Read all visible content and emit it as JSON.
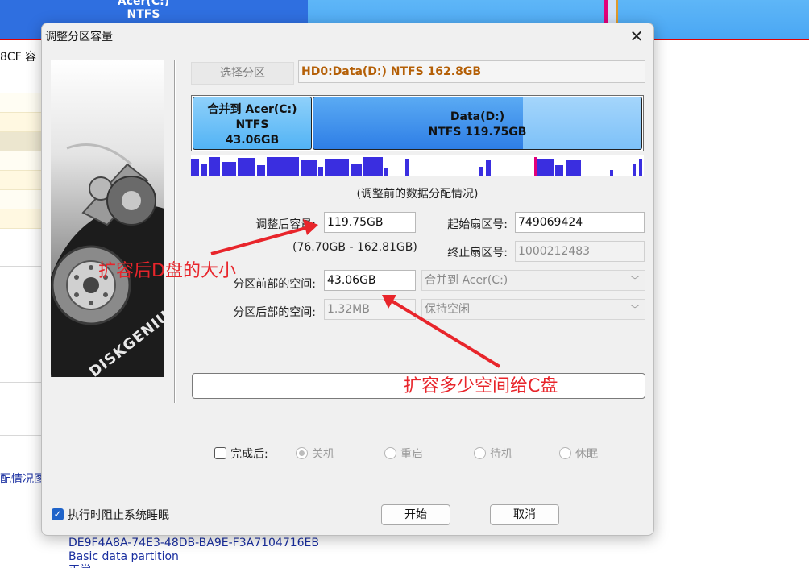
{
  "background": {
    "partition_c": {
      "name": "Acer(C:)",
      "fs": "NTFS"
    },
    "columns_text": "8CF  容",
    "link_text": "配情况图",
    "info_lines": [
      "DE9F4A8A-74E3-48DB-BA9E-F3A7104716EB",
      "Basic data partition",
      "正常"
    ]
  },
  "dialog": {
    "title": "调整分区容量",
    "close_symbol": "✕",
    "brand": "DISKGENIUS",
    "select_partition_label": "选择分区",
    "current_partition": "HD0:Data(D:) NTFS 162.8GB",
    "partition_bar": {
      "merge": {
        "line1": "合并到 Acer(C:)",
        "line2": "NTFS",
        "line3": "43.06GB"
      },
      "data": {
        "line1": "Data(D:)",
        "line2": "NTFS 119.75GB"
      }
    },
    "distribution_caption": "(调整前的数据分配情况)",
    "fields": {
      "resized_capacity_label": "调整后容量:",
      "resized_capacity_value": "119.75GB",
      "range_text": "(76.70GB - 162.81GB)",
      "start_sector_label": "起始扇区号:",
      "start_sector_value": "749069424",
      "end_sector_label": "终止扇区号:",
      "end_sector_value": "1000212483",
      "space_before_label": "分区前部的空间:",
      "space_before_value": "43.06GB",
      "space_before_action": "合并到 Acer(C:)",
      "space_after_label": "分区后部的空间:",
      "space_after_value": "1.32MB",
      "space_after_action": "保持空闲"
    },
    "after_completion": {
      "label": "完成后:",
      "options": [
        "关机",
        "重启",
        "待机",
        "休眠"
      ],
      "selected": "关机",
      "checked": false
    },
    "prevent_sleep": {
      "label": "执行时阻止系统睡眠",
      "checked": true
    },
    "buttons": {
      "start": "开始",
      "cancel": "取消"
    }
  },
  "annotations": {
    "size_note": "扩容后D盘的大小",
    "space_note": "扩容多少空间给C盘",
    "color": "#e8252b"
  }
}
